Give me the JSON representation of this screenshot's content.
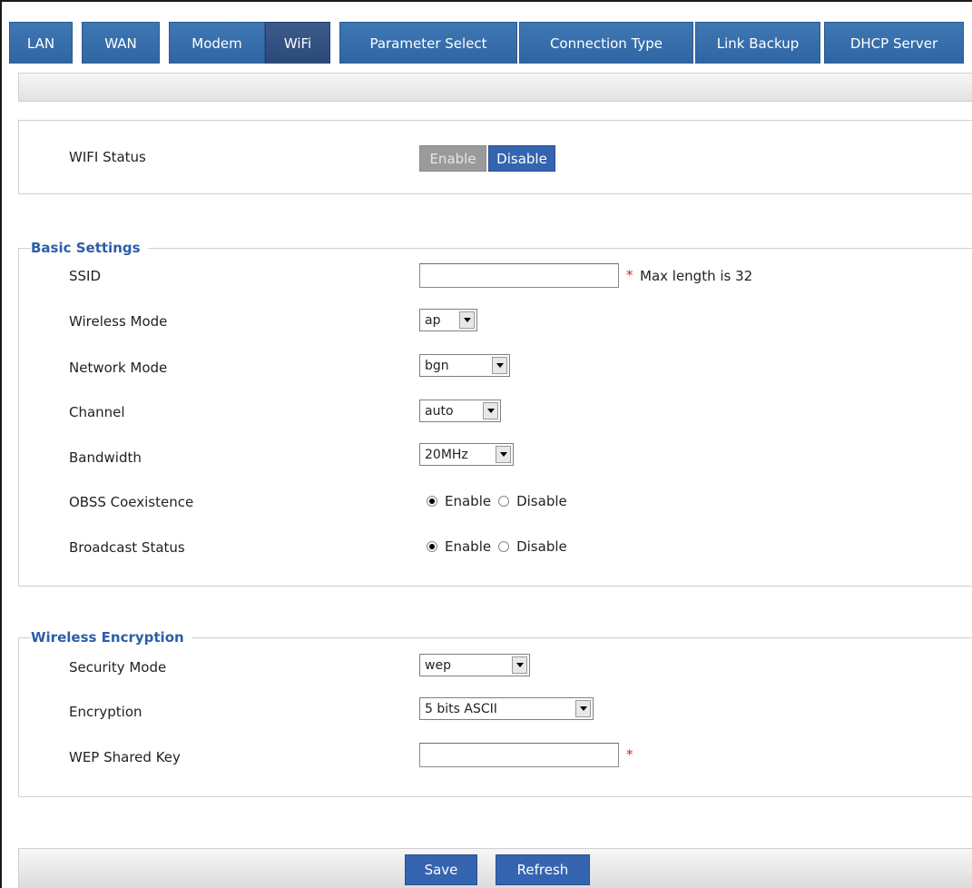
{
  "tabs": [
    {
      "label": "LAN"
    },
    {
      "label": "WAN"
    },
    {
      "label": "Modem"
    },
    {
      "label": "WiFi"
    },
    {
      "label": "Parameter Select"
    },
    {
      "label": "Connection Type"
    },
    {
      "label": "Link Backup"
    },
    {
      "label": "DHCP Server"
    }
  ],
  "active_tab": "WiFi",
  "wifi_status": {
    "label": "WIFI Status",
    "enable_label": "Enable",
    "disable_label": "Disable",
    "selected": "Enable"
  },
  "basic": {
    "legend": "Basic Settings",
    "ssid_label": "SSID",
    "ssid_value": "",
    "ssid_required": "*",
    "ssid_hint": "Max length is 32",
    "wireless_mode_label": "Wireless Mode",
    "wireless_mode_value": "ap",
    "network_mode_label": "Network Mode",
    "network_mode_value": "bgn",
    "channel_label": "Channel",
    "channel_value": "auto",
    "bandwidth_label": "Bandwidth",
    "bandwidth_value": "20MHz",
    "obss_label": "OBSS Coexistence",
    "obss_enable": "Enable",
    "obss_disable": "Disable",
    "obss_selected": "Enable",
    "broadcast_label": "Broadcast Status",
    "broadcast_enable": "Enable",
    "broadcast_disable": "Disable",
    "broadcast_selected": "Enable"
  },
  "encryption": {
    "legend": "Wireless Encryption",
    "security_mode_label": "Security Mode",
    "security_mode_value": "wep",
    "encryption_label": "Encryption",
    "encryption_value": "5 bits ASCII",
    "wep_key_label": "WEP Shared Key",
    "wep_key_value": "",
    "wep_key_required": "*"
  },
  "actions": {
    "save_label": "Save",
    "refresh_label": "Refresh"
  },
  "colors": {
    "tab_blue": "#3a6fae",
    "button_blue": "#3564b0",
    "legend_blue": "#2b5ea8",
    "required_red": "#e02020"
  }
}
